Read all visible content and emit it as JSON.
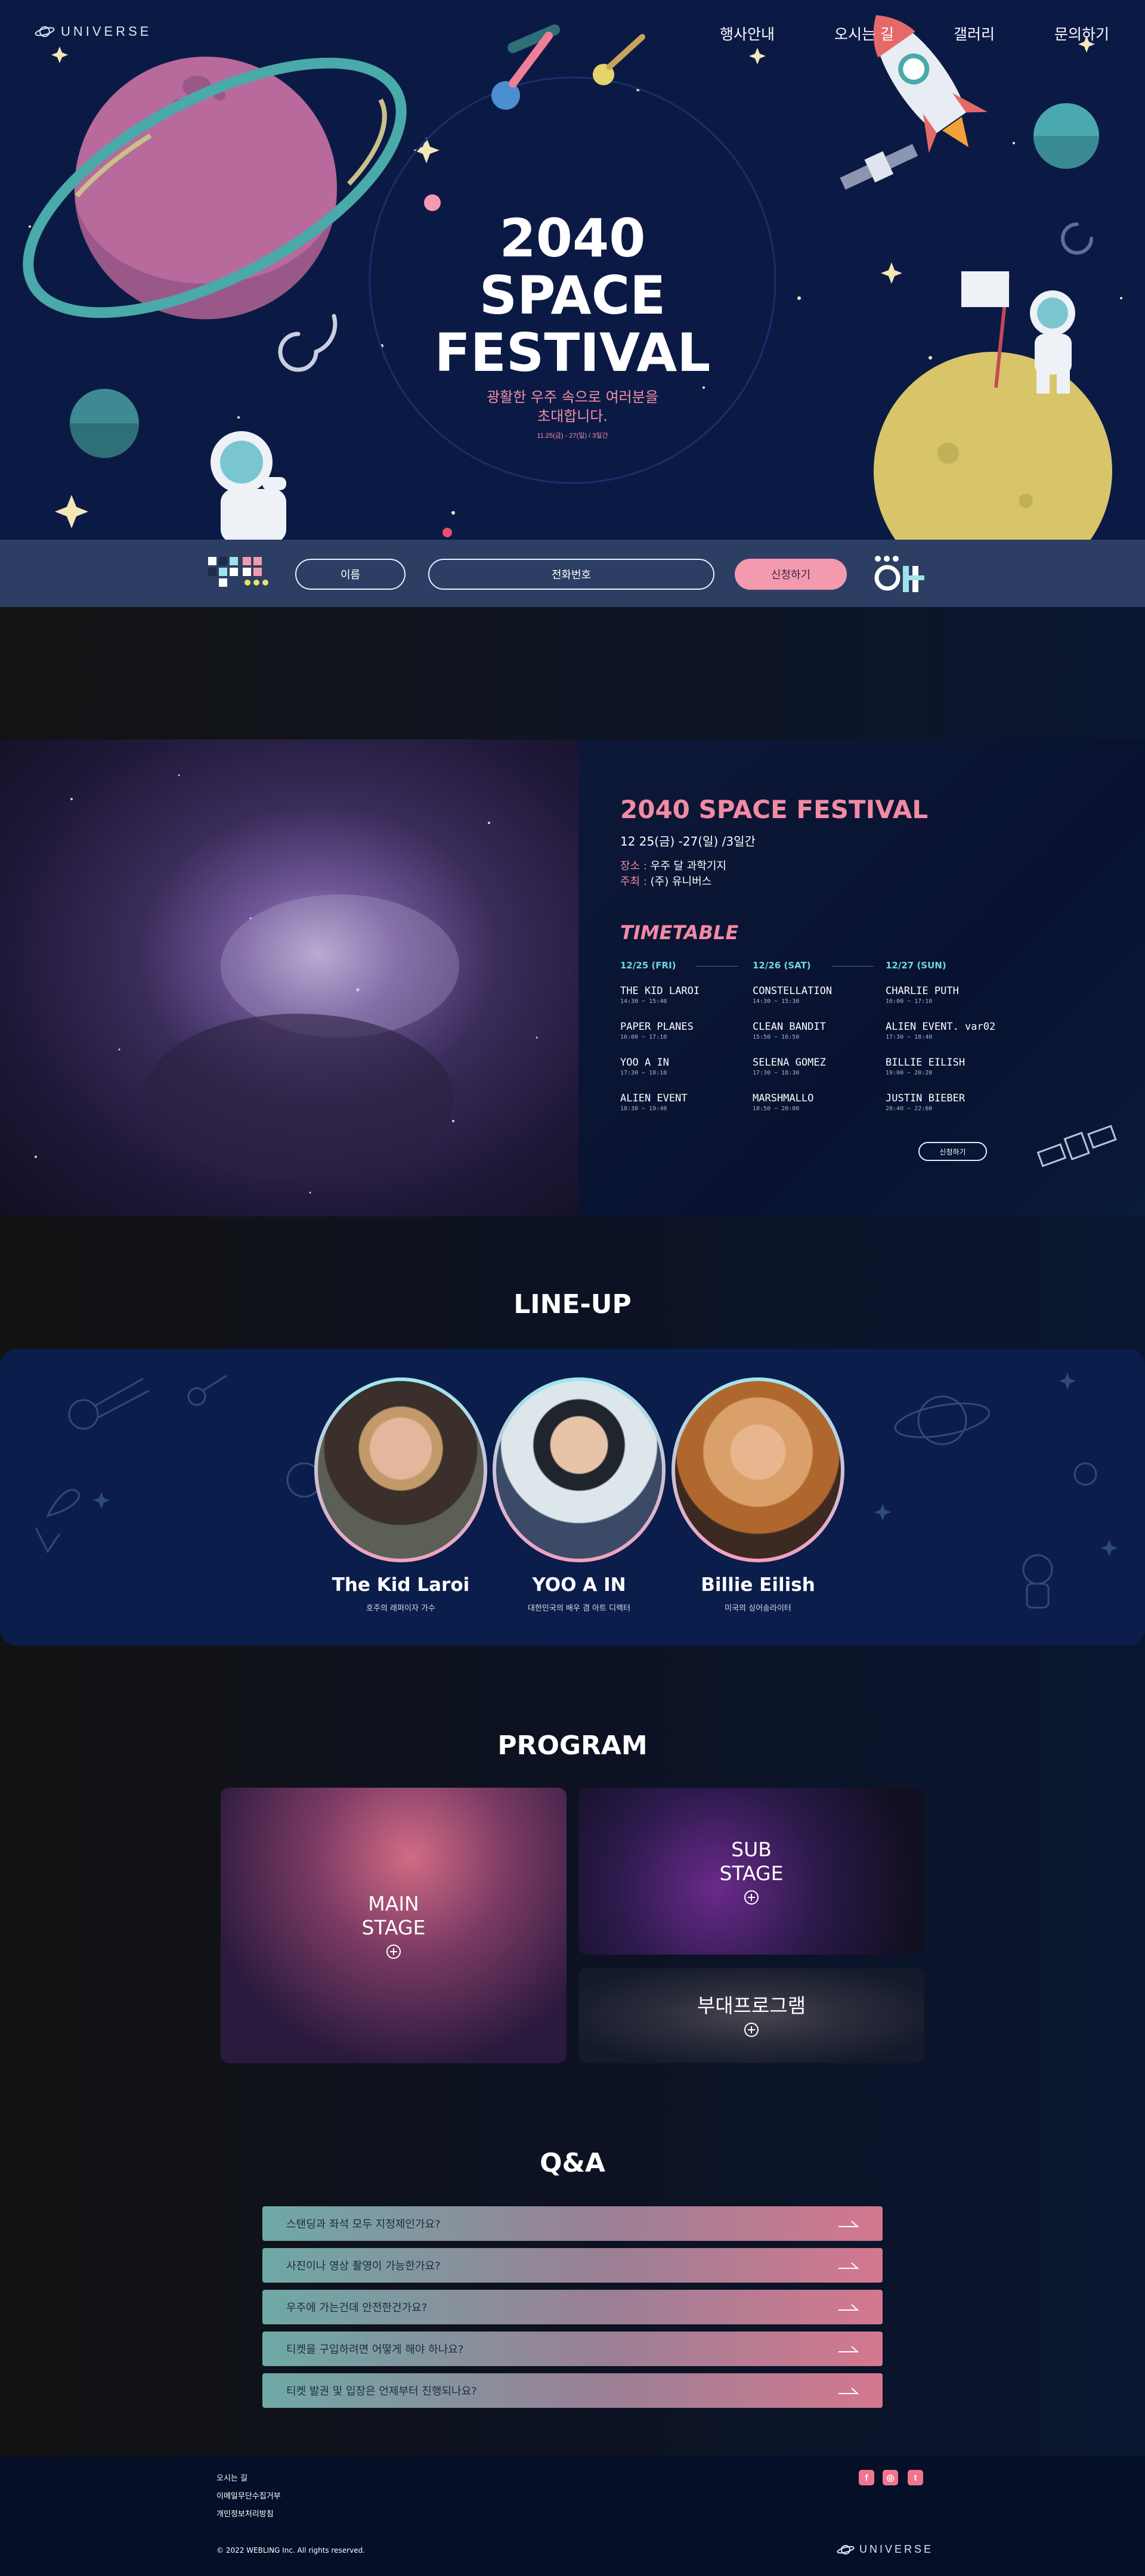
{
  "brand": {
    "logo_text": "UNIVERSE"
  },
  "nav": {
    "items": [
      "행사안내",
      "오시는 길",
      "갤러리",
      "문의하기"
    ]
  },
  "hero": {
    "title_line1": "2040",
    "title_line2": "SPACE",
    "title_line3": "FESTIVAL",
    "subtitle_line1": "광활한 우주 속으로 여러분을",
    "subtitle_line2": "초대합니다.",
    "date": "11.25(금) - 27(일) / 3일간"
  },
  "form": {
    "name_label": "이름",
    "phone_label": "전화번호",
    "submit_label": "신청하기"
  },
  "festival": {
    "title": "2040 SPACE FESTIVAL",
    "dates": "12 25(금) -27(일) /3일간",
    "place_key": "장소 :",
    "place_value": " 우주 달 과학기지",
    "host_key": "주최 :",
    "host_value": " (주) 유니버스",
    "timetable_title": "TIMETABLE",
    "days": [
      "12/25 (FRI)",
      "12/26 (SAT)",
      "12/27 (SUN)"
    ],
    "acts": [
      [
        {
          "name": "THE KID LAROI",
          "time": "14:30 ~ 15:40"
        },
        {
          "name": "PAPER PLANES",
          "time": "16:00 ~ 17:10"
        },
        {
          "name": "YOO A IN",
          "time": "17:30 ~ 18:10"
        },
        {
          "name": "ALIEN EVENT",
          "time": "18:30 ~ 19:40"
        }
      ],
      [
        {
          "name": "CONSTELLATION",
          "time": "14:30 ~ 15:30"
        },
        {
          "name": "CLEAN BANDIT",
          "time": "15:50 ~ 16:50"
        },
        {
          "name": "SELENA GOMEZ",
          "time": "17:30 ~ 18:30"
        },
        {
          "name": "MARSHMALLO",
          "time": "18:50 ~ 20:00"
        }
      ],
      [
        {
          "name": "CHARLIE PUTH",
          "time": "16:00 ~ 17:10"
        },
        {
          "name": "ALIEN EVENT. var02",
          "time": "17:30 ~ 18:40"
        },
        {
          "name": "BILLIE EILISH",
          "time": "19:00 ~ 20:20"
        },
        {
          "name": "JUSTIN BIEBER",
          "time": "20:40 ~ 22:00"
        }
      ]
    ],
    "apply_label": "신청하기"
  },
  "lineup": {
    "title": "LINE-UP",
    "artists": [
      {
        "name": "The Kid Laroi",
        "desc": "호주의 래퍼이자 가수"
      },
      {
        "name": "YOO A IN",
        "desc": "대한민국의 배우 겸 아트 디렉터"
      },
      {
        "name": "Billie Eilish",
        "desc": "미국의 싱어송라이터"
      }
    ]
  },
  "program": {
    "title": "PROGRAM",
    "main_l1": "MAIN",
    "main_l2": "STAGE",
    "sub_l1": "SUB",
    "sub_l2": "STAGE",
    "extra": "부대프로그램"
  },
  "qa": {
    "title": "Q&A",
    "items": [
      "스탠딩과 좌석 모두 지정제인가요?",
      "사진이나 영상 촬영이 가능한가요?",
      "우주에 가는건데 안전한건가요?",
      "티켓을 구입하려면 어떻게 해야 하나요?",
      "티켓 발권 및 입장은 언제부터 진행되나요?"
    ]
  },
  "footer": {
    "links": [
      "오시는 길",
      "이메일무단수집거부",
      "개인정보처리방침"
    ],
    "copyright": "© 2022 WEBLING Inc. All rights reserved.",
    "logo_text": "UNIVERSE",
    "social": [
      "f",
      "◎",
      "t"
    ]
  },
  "colors": {
    "pink": "#f28aa4",
    "navy": "#0b1a45",
    "mint": "#6fd6e6"
  }
}
